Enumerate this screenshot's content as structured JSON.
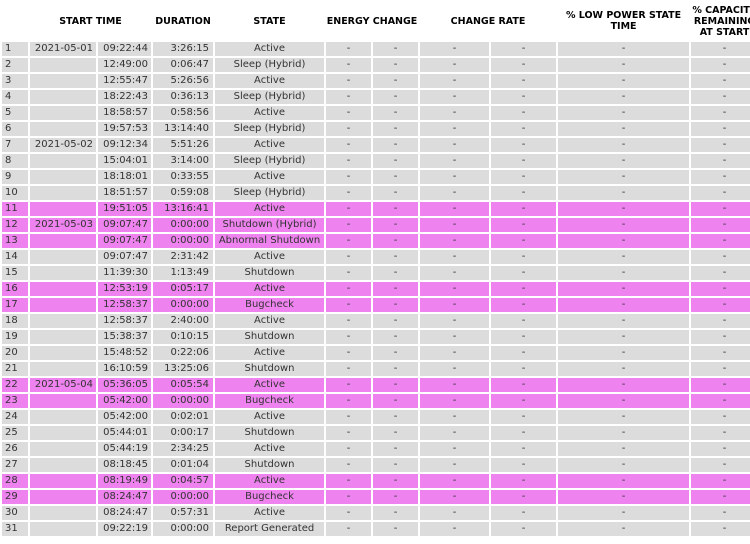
{
  "headers": {
    "start_time": "START TIME",
    "duration": "DURATION",
    "state": "STATE",
    "energy_change": "ENERGY CHANGE",
    "change_rate": "CHANGE RATE",
    "low_power": "% LOW POWER STATE TIME",
    "capacity": "% CAPACITY REMAINING AT START"
  },
  "colors": {
    "row_normal": "#dcdcdc",
    "row_highlight": "#ee82ee"
  },
  "rows": [
    {
      "idx": "1",
      "date": "2021-05-01",
      "time": "09:22:44",
      "duration": "3:26:15",
      "state": "Active",
      "hl": false
    },
    {
      "idx": "2",
      "date": "",
      "time": "12:49:00",
      "duration": "0:06:47",
      "state": "Sleep (Hybrid)",
      "hl": false
    },
    {
      "idx": "3",
      "date": "",
      "time": "12:55:47",
      "duration": "5:26:56",
      "state": "Active",
      "hl": false
    },
    {
      "idx": "4",
      "date": "",
      "time": "18:22:43",
      "duration": "0:36:13",
      "state": "Sleep (Hybrid)",
      "hl": false
    },
    {
      "idx": "5",
      "date": "",
      "time": "18:58:57",
      "duration": "0:58:56",
      "state": "Active",
      "hl": false
    },
    {
      "idx": "6",
      "date": "",
      "time": "19:57:53",
      "duration": "13:14:40",
      "state": "Sleep (Hybrid)",
      "hl": false
    },
    {
      "idx": "7",
      "date": "2021-05-02",
      "time": "09:12:34",
      "duration": "5:51:26",
      "state": "Active",
      "hl": false
    },
    {
      "idx": "8",
      "date": "",
      "time": "15:04:01",
      "duration": "3:14:00",
      "state": "Sleep (Hybrid)",
      "hl": false
    },
    {
      "idx": "9",
      "date": "",
      "time": "18:18:01",
      "duration": "0:33:55",
      "state": "Active",
      "hl": false
    },
    {
      "idx": "10",
      "date": "",
      "time": "18:51:57",
      "duration": "0:59:08",
      "state": "Sleep (Hybrid)",
      "hl": false
    },
    {
      "idx": "11",
      "date": "",
      "time": "19:51:05",
      "duration": "13:16:41",
      "state": "Active",
      "hl": true
    },
    {
      "idx": "12",
      "date": "2021-05-03",
      "time": "09:07:47",
      "duration": "0:00:00",
      "state": "Shutdown (Hybrid)",
      "hl": true
    },
    {
      "idx": "13",
      "date": "",
      "time": "09:07:47",
      "duration": "0:00:00",
      "state": "Abnormal Shutdown",
      "hl": true
    },
    {
      "idx": "14",
      "date": "",
      "time": "09:07:47",
      "duration": "2:31:42",
      "state": "Active",
      "hl": false
    },
    {
      "idx": "15",
      "date": "",
      "time": "11:39:30",
      "duration": "1:13:49",
      "state": "Shutdown",
      "hl": false
    },
    {
      "idx": "16",
      "date": "",
      "time": "12:53:19",
      "duration": "0:05:17",
      "state": "Active",
      "hl": true
    },
    {
      "idx": "17",
      "date": "",
      "time": "12:58:37",
      "duration": "0:00:00",
      "state": "Bugcheck",
      "hl": true
    },
    {
      "idx": "18",
      "date": "",
      "time": "12:58:37",
      "duration": "2:40:00",
      "state": "Active",
      "hl": false
    },
    {
      "idx": "19",
      "date": "",
      "time": "15:38:37",
      "duration": "0:10:15",
      "state": "Shutdown",
      "hl": false
    },
    {
      "idx": "20",
      "date": "",
      "time": "15:48:52",
      "duration": "0:22:06",
      "state": "Active",
      "hl": false
    },
    {
      "idx": "21",
      "date": "",
      "time": "16:10:59",
      "duration": "13:25:06",
      "state": "Shutdown",
      "hl": false
    },
    {
      "idx": "22",
      "date": "2021-05-04",
      "time": "05:36:05",
      "duration": "0:05:54",
      "state": "Active",
      "hl": true
    },
    {
      "idx": "23",
      "date": "",
      "time": "05:42:00",
      "duration": "0:00:00",
      "state": "Bugcheck",
      "hl": true
    },
    {
      "idx": "24",
      "date": "",
      "time": "05:42:00",
      "duration": "0:02:01",
      "state": "Active",
      "hl": false
    },
    {
      "idx": "25",
      "date": "",
      "time": "05:44:01",
      "duration": "0:00:17",
      "state": "Shutdown",
      "hl": false
    },
    {
      "idx": "26",
      "date": "",
      "time": "05:44:19",
      "duration": "2:34:25",
      "state": "Active",
      "hl": false
    },
    {
      "idx": "27",
      "date": "",
      "time": "08:18:45",
      "duration": "0:01:04",
      "state": "Shutdown",
      "hl": false
    },
    {
      "idx": "28",
      "date": "",
      "time": "08:19:49",
      "duration": "0:04:57",
      "state": "Active",
      "hl": true
    },
    {
      "idx": "29",
      "date": "",
      "time": "08:24:47",
      "duration": "0:00:00",
      "state": "Bugcheck",
      "hl": true
    },
    {
      "idx": "30",
      "date": "",
      "time": "08:24:47",
      "duration": "0:57:31",
      "state": "Active",
      "hl": false
    },
    {
      "idx": "31",
      "date": "",
      "time": "09:22:19",
      "duration": "0:00:00",
      "state": "Report Generated",
      "hl": false
    }
  ],
  "placeholder": "-"
}
